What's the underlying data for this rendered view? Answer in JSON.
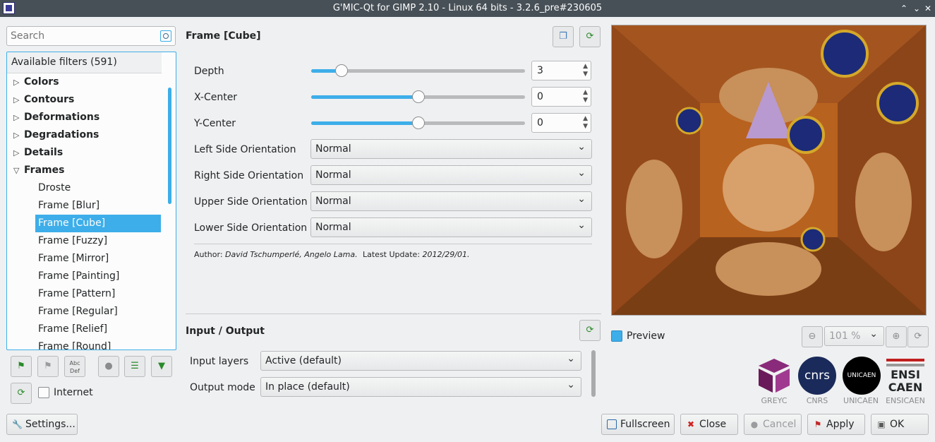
{
  "window": {
    "title": "G'MIC-Qt for GIMP 2.10 - Linux 64 bits - 3.2.6_pre#230605"
  },
  "search": {
    "placeholder": "Search"
  },
  "filters": {
    "header": "Available filters (591)",
    "categories": [
      "Colors",
      "Contours",
      "Deformations",
      "Degradations",
      "Details",
      "Frames"
    ],
    "frames_items": [
      "Droste",
      "Frame [Blur]",
      "Frame [Cube]",
      "Frame [Fuzzy]",
      "Frame [Mirror]",
      "Frame [Painting]",
      "Frame [Pattern]",
      "Frame [Regular]",
      "Frame [Relief]",
      "Frame [Round]"
    ]
  },
  "left_toolbar": {
    "internet_label": "Internet",
    "settings_label": "Settings..."
  },
  "filter": {
    "title": "Frame [Cube]",
    "params": {
      "depth": {
        "label": "Depth",
        "value": "3",
        "fraction": 0.12
      },
      "xcenter": {
        "label": "X-Center",
        "value": "0",
        "fraction": 0.5
      },
      "ycenter": {
        "label": "Y-Center",
        "value": "0",
        "fraction": 0.5
      },
      "left": {
        "label": "Left Side Orientation",
        "value": "Normal"
      },
      "right": {
        "label": "Right Side Orientation",
        "value": "Normal"
      },
      "upper": {
        "label": "Upper Side Orientation",
        "value": "Normal"
      },
      "lower": {
        "label": "Lower Side Orientation",
        "value": "Normal"
      }
    },
    "author_label": "Author:",
    "author": "David Tschumperlé, Angelo Lama.",
    "update_label": "Latest Update:",
    "update": "2012/29/01."
  },
  "io": {
    "title": "Input / Output",
    "input_label": "Input layers",
    "input_value": "Active (default)",
    "output_label": "Output mode",
    "output_value": "In place (default)"
  },
  "preview": {
    "label": "Preview",
    "checked": true,
    "zoom": "101 %"
  },
  "logos": [
    "GREYC",
    "CNRS",
    "UNICAEN",
    "ENSICAEN"
  ],
  "logo_marks": {
    "cnrs": "cnrs",
    "unicaen": "UNICAEN",
    "ensicaen": "ENSI CAEN"
  },
  "buttons": {
    "fullscreen": "Fullscreen",
    "close": "Close",
    "cancel": "Cancel",
    "apply": "Apply",
    "ok": "OK"
  },
  "colors": {
    "accent": "#3daee9",
    "titlebar": "#475057",
    "background": "#eff0f1"
  }
}
